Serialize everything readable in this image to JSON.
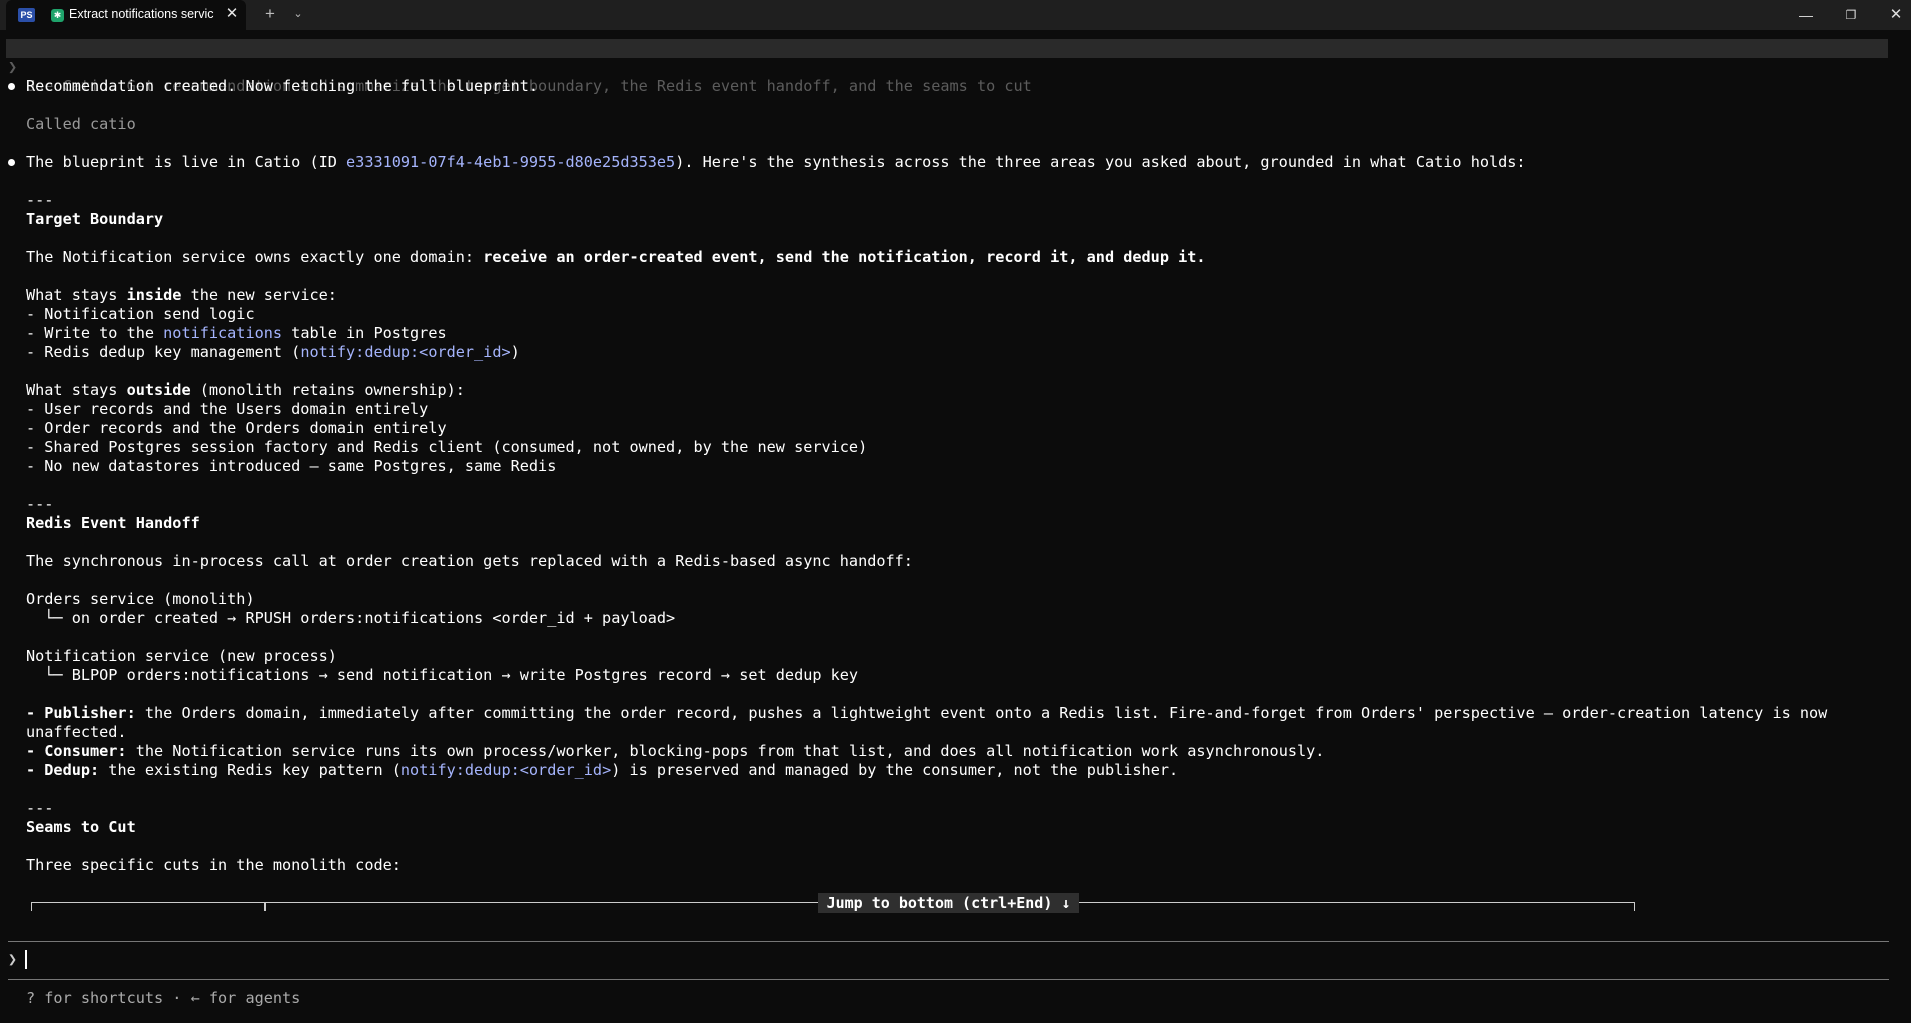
{
  "window": {
    "tab_title": "Extract notifications servic",
    "ps_icon": "PS",
    "app_icon": "✱",
    "close_glyph": "✕",
    "new_tab_glyph": "+",
    "dropdown_glyph": "⌄",
    "minimize_glyph": "—",
    "maximize_glyph": "❐",
    "win_close_glyph": "✕"
  },
  "prompt": {
    "chevron": "❯",
    "text": "Use Catio. Get recommendation and summarize the target boundary, the Redis event handoff, and the seams to cut"
  },
  "messages": {
    "m1": "Recommendation created. Now fetching the full blueprint.",
    "called": "Called catio",
    "m2_pre": "The blueprint is live in Catio (ID ",
    "m2_id": "e3331091-07f4-4eb1-9955-d80e25d353e5",
    "m2_post": "). Here's the synthesis across the three areas you asked about, grounded in what Catio holds:"
  },
  "sections": {
    "rule": "---",
    "target": {
      "heading": "Target Boundary",
      "intro_pre": "The Notification service owns exactly one domain: ",
      "intro_bold": "receive an order-created event, send the notification, record it, and dedup it.",
      "inside_pre": "What stays ",
      "inside_bold": "inside",
      "inside_post": " the new service:",
      "in1": "- Notification send logic",
      "in2_pre": "- Write to the ",
      "in2_link": "notifications",
      "in2_post": " table in Postgres",
      "in3_pre": "- Redis dedup key management (",
      "in3_link": "notify:dedup:<order_id>",
      "in3_post": ")",
      "outside_pre": "What stays ",
      "outside_bold": "outside",
      "outside_post": " (monolith retains ownership):",
      "out1": "- User records and the Users domain entirely",
      "out2": "- Order records and the Orders domain entirely",
      "out3": "- Shared Postgres session factory and Redis client (consumed, not owned, by the new service)",
      "out4": "- No new datastores introduced — same Postgres, same Redis"
    },
    "redis": {
      "heading": "Redis Event Handoff",
      "intro": "The synchronous in-process call at order creation gets replaced with a Redis-based async handoff:",
      "orders_svc": "Orders service (monolith)",
      "orders_flow": "  └─ on order created → RPUSH orders:notifications <order_id + payload>",
      "notif_svc": "Notification service (new process)",
      "notif_flow": "  └─ BLPOP orders:notifications → send notification → write Postgres record → set dedup key",
      "pub_label": "- Publisher:",
      "pub_text": " the Orders domain, immediately after committing the order record, pushes a lightweight event onto a Redis list. Fire-and-forget from Orders' perspective — order-creation latency is now",
      "pub_cont": "unaffected.",
      "con_label": "- Consumer:",
      "con_text": " the Notification service runs its own process/worker, blocking-pops from that list, and does all notification work asynchronously.",
      "dedup_label": "- Dedup:",
      "dedup_pre": " the existing Redis key pattern (",
      "dedup_link": "notify:dedup:<order_id>",
      "dedup_post": ") is preserved and managed by the consumer, not the publisher."
    },
    "seams": {
      "heading": "Seams to Cut",
      "intro": "Three specific cuts in the monolith code:"
    }
  },
  "jump_banner": "Jump to bottom (ctrl+End) ↓",
  "input": {
    "chevron": "❯"
  },
  "footer": "? for shortcuts · ← for agents"
}
